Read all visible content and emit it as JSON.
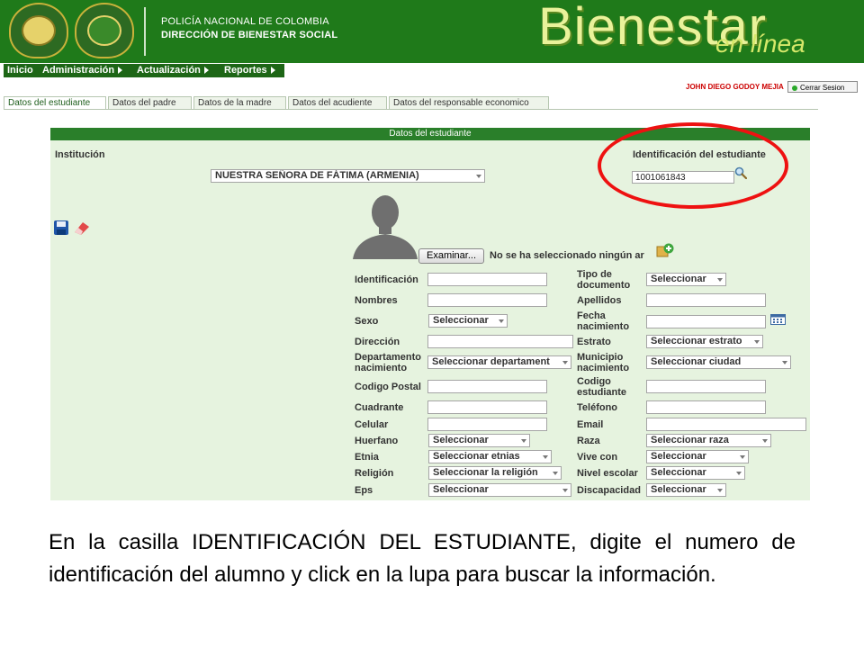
{
  "header": {
    "line1": "POLICÍA NACIONAL DE COLOMBIA",
    "line2": "DIRECCIÓN DE BIENESTAR SOCIAL",
    "brand_title": "Bienestar",
    "brand_subtitle": "en línea"
  },
  "nav": {
    "items": [
      "Inicio",
      "Administración",
      "Actualización",
      "Reportes"
    ]
  },
  "user": {
    "name": "JOHN DIEGO GODOY MEJIA",
    "logout_label": "Cerrar Sesion"
  },
  "tabs": [
    "Datos del estudiante",
    "Datos del padre",
    "Datos de la madre",
    "Datos del acudiente",
    "Datos del responsable economico"
  ],
  "form": {
    "panel_title": "Datos del estudiante",
    "institucion_label": "Institución",
    "institucion_value": "NUESTRA SEÑORA DE FÁTIMA (ARMENIA)",
    "id_label": "Identificación del estudiante",
    "id_value": "1001061843",
    "browse_label": "Examinar...",
    "file_status": "No se ha seleccionado ningún ar",
    "fields": {
      "identificacion": "Identificación",
      "tipo_documento": "Tipo de documento",
      "tipo_documento_value": "Seleccionar",
      "nombres": "Nombres",
      "apellidos": "Apellidos",
      "sexo": "Sexo",
      "sexo_value": "Seleccionar",
      "fecha_nacimiento": "Fecha nacimiento",
      "direccion": "Dirección",
      "estrato": "Estrato",
      "estrato_value": "Seleccionar estrato",
      "departamento": "Departamento nacimiento",
      "departamento_value": "Seleccionar departament",
      "municipio": "Municipio nacimiento",
      "municipio_value": "Seleccionar ciudad",
      "codigo_postal": "Codigo Postal",
      "codigo_estudiante": "Codigo estudiante",
      "cuadrante": "Cuadrante",
      "telefono": "Teléfono",
      "celular": "Celular",
      "email": "Email",
      "huerfano": "Huerfano",
      "huerfano_value": "Seleccionar",
      "raza": "Raza",
      "raza_value": "Seleccionar raza",
      "etnia": "Etnia",
      "etnia_value": "Seleccionar etnias",
      "vive_con": "Vive con",
      "vive_con_value": "Seleccionar",
      "religion": "Religión",
      "religion_value": "Seleccionar la religión",
      "nivel_escolar": "Nivel escolar",
      "nivel_escolar_value": "Seleccionar",
      "eps": "Eps",
      "eps_value": "Seleccionar",
      "discapacidad": "Discapacidad",
      "discapacidad_value": "Seleccionar"
    }
  },
  "instruction": "En la casilla IDENTIFICACIÓN DEL ESTUDIANTE, digite el numero de identificación del alumno y click en la lupa para buscar la información.",
  "colors": {
    "header_green": "#1f7a1a",
    "panel_bg": "#e6f3df",
    "highlight_red": "#ee1111",
    "user_red": "#cc0000"
  },
  "icons": [
    "shield-logo-icon",
    "police-logo-icon",
    "search-icon",
    "save-icon",
    "eraser-icon",
    "add-photo-icon",
    "calendar-icon"
  ]
}
